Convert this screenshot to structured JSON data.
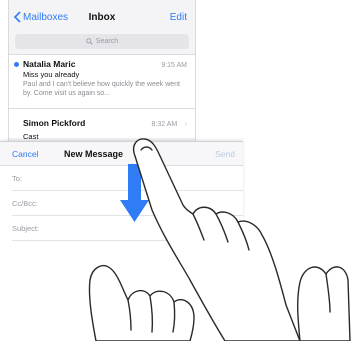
{
  "inbox": {
    "back_label": "Mailboxes",
    "title": "Inbox",
    "edit_label": "Edit",
    "search_placeholder": "Search",
    "messages": [
      {
        "sender": "Natalia Maric",
        "time": "9:15 AM",
        "subject": "Miss you already",
        "preview": "Paul and I can't believe how quickly the week went by. Come visit us again so...",
        "unread": true
      },
      {
        "sender": "Simon Pickford",
        "time": "8:32 AM",
        "subject": "Cast",
        "unread": false
      }
    ]
  },
  "compose": {
    "cancel_label": "Cancel",
    "title": "New Message",
    "send_label": "Send",
    "fields": [
      {
        "label": "To:"
      },
      {
        "label": "Cc/Bcc:"
      },
      {
        "label": "Subject:"
      }
    ]
  },
  "colors": {
    "accent": "#2f7cf6",
    "arrow": "#2f7cf6"
  },
  "icons": [
    "chevron-left-icon",
    "search-icon",
    "unread-dot-icon",
    "chevron-right-icon",
    "swipe-down-arrow-icon",
    "hand-icon"
  ]
}
